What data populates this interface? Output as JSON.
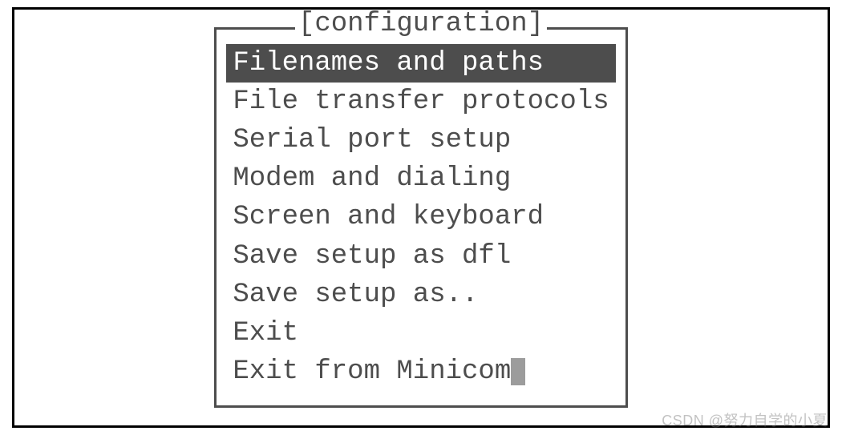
{
  "menu": {
    "title": "[configuration]",
    "selected_index": 0,
    "items": [
      {
        "label": "Filenames and paths"
      },
      {
        "label": "File transfer protocols"
      },
      {
        "label": "Serial port setup"
      },
      {
        "label": "Modem and dialing"
      },
      {
        "label": "Screen and keyboard"
      },
      {
        "label": "Save setup as dfl"
      },
      {
        "label": "Save setup as.."
      },
      {
        "label": "Exit"
      },
      {
        "label": "Exit from Minicom"
      }
    ]
  },
  "watermark": "CSDN @努力自学的小夏"
}
